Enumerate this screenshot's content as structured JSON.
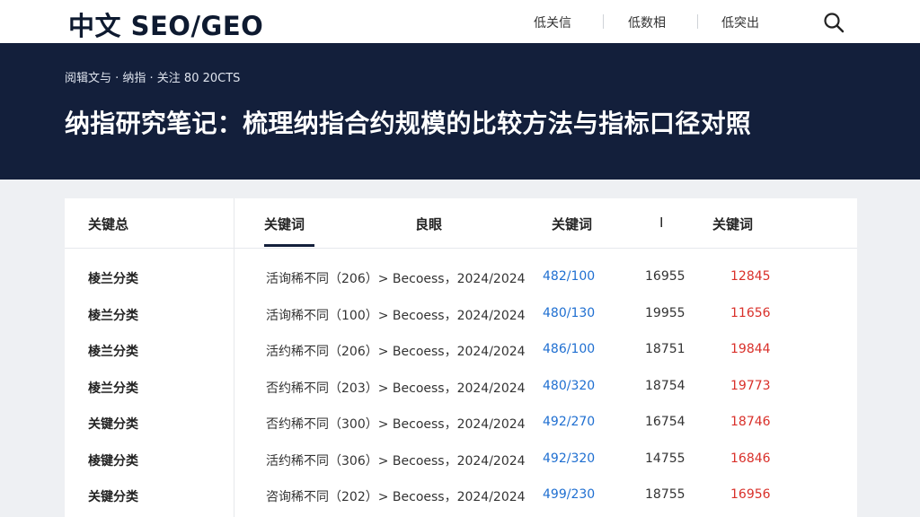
{
  "header": {
    "logo": "中文 SEO/GEO",
    "nav": [
      "低关信",
      "低数相",
      "低突出"
    ]
  },
  "hero": {
    "breadcrumb": "阅辑文与 · 纳指 · 关注   80 20CTS",
    "title": "纳指研究笔记：梳理纳指合约规模的比较方法与指标口径对照"
  },
  "table": {
    "headers": [
      "关键总",
      "关键词",
      "良眼",
      "关键词",
      "I",
      "关键词"
    ],
    "rows": [
      {
        "category": "棱兰分类",
        "desc": "活询稀不同（206）> Becoess，2024/2024",
        "ratio": "482/100",
        "num": "16955",
        "red": "12845"
      },
      {
        "category": "棱兰分类",
        "desc": "活询稀不同（100）> Becoess，2024/2024",
        "ratio": "480/130",
        "num": "19955",
        "red": "11656"
      },
      {
        "category": "棱兰分类",
        "desc": "活约稀不同（206）> Becoess，2024/2024",
        "ratio": "486/100",
        "num": "18751",
        "red": "19844"
      },
      {
        "category": "棱兰分类",
        "desc": "否约稀不同（203）> Becoess，2024/2024",
        "ratio": "480/320",
        "num": "18754",
        "red": "19773"
      },
      {
        "category": "关键分类",
        "desc": "否约稀不同（300）> Becoess，2024/2024",
        "ratio": "492/270",
        "num": "16754",
        "red": "18746"
      },
      {
        "category": "棱键分类",
        "desc": "活约稀不同（306）> Becoess，2024/2024",
        "ratio": "492/320",
        "num": "14755",
        "red": "16846"
      },
      {
        "category": "关键分类",
        "desc": "咨询稀不同（202）> Becoess，2024/2024",
        "ratio": "499/230",
        "num": "18755",
        "red": "16956"
      }
    ]
  },
  "colors": {
    "hero_bg": "#131f3b",
    "link_blue": "#1f6fd1",
    "alert_red": "#d9302a"
  },
  "icons": {
    "search": "search-icon"
  }
}
